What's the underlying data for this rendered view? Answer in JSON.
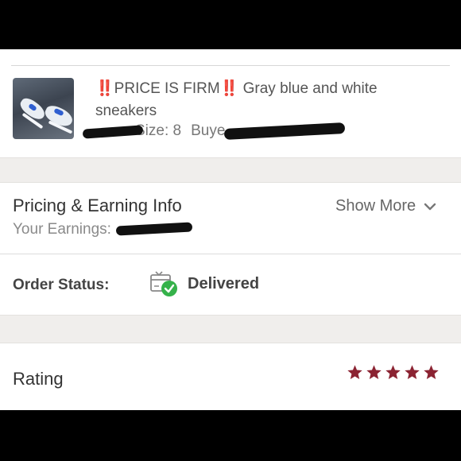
{
  "item": {
    "warning_marks": "‼️",
    "title_prefix": "PRICE IS FIRM",
    "title_rest": " Gray blue and white sneakers",
    "size": "Size: 8",
    "buyer_label": "Buye"
  },
  "pricing": {
    "title": "Pricing & Earning Info",
    "earnings_label": "Your Earnings:",
    "show_more": "Show More"
  },
  "order": {
    "status_label": "Order Status:",
    "status_value": "Delivered"
  },
  "rating": {
    "label": "Rating",
    "stars": 5,
    "star_color": "#8b2332"
  },
  "colors": {
    "accent_green": "#35b24a",
    "bang_red": "#d4262d",
    "section_gap": "#f0eeec"
  }
}
